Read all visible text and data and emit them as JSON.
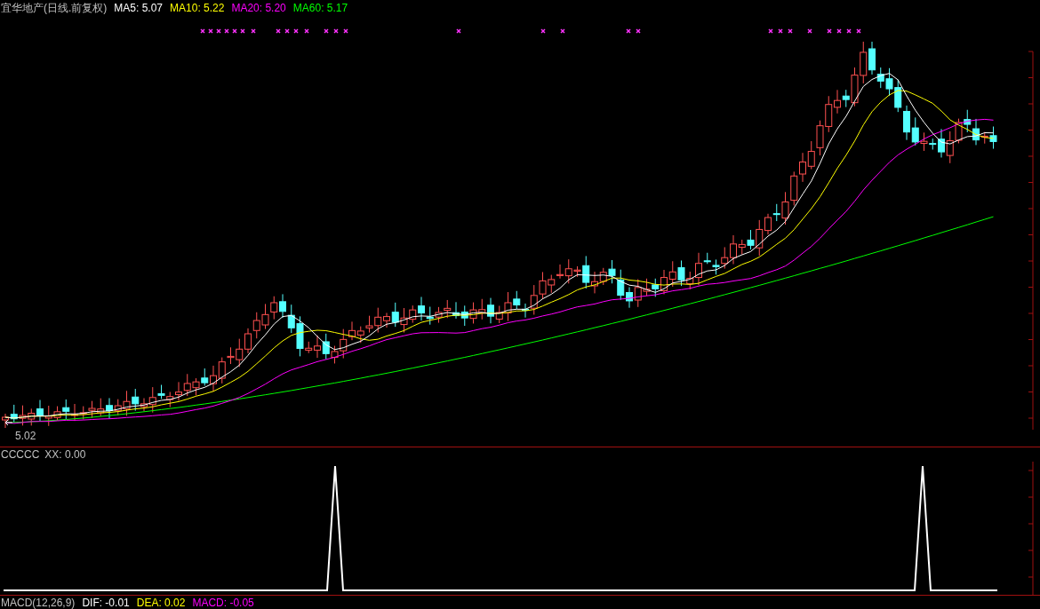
{
  "title": "宜华地产(日线.前复权)",
  "ma_legend": [
    {
      "label": "MA5: 5.07",
      "color": "#ffffff"
    },
    {
      "label": "MA10: 5.22",
      "color": "#ffff00"
    },
    {
      "label": "MA20: 5.20",
      "color": "#ff00ff"
    },
    {
      "label": "MA60: 5.17",
      "color": "#00ff00"
    }
  ],
  "low_label": "5.02",
  "indicator": {
    "name": "CCCCC",
    "reading": "XX: 0.00"
  },
  "macd_legend": [
    {
      "label": "MACD(12,26,9)",
      "color": "#c0c0c0"
    },
    {
      "label": "DIF: -0.01",
      "color": "#ffffff"
    },
    {
      "label": "DEA: 0.02",
      "color": "#ffff00"
    },
    {
      "label": "MACD: -0.05",
      "color": "#ff00ff"
    }
  ]
}
